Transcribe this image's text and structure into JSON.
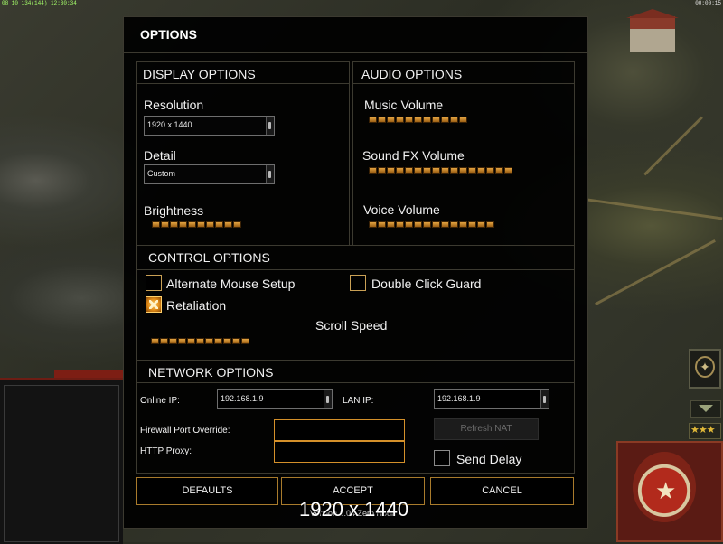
{
  "hud": {
    "top_left_readout": "08 10 134(144) 12:30:34",
    "top_right_readout": "00:00:15"
  },
  "dialog": {
    "title": "OPTIONS",
    "display": {
      "header": "DISPLAY OPTIONS",
      "resolution_label": "Resolution",
      "resolution_value": "1920 x 1440",
      "detail_label": "Detail",
      "detail_value": "Custom",
      "brightness_label": "Brightness",
      "brightness_segments": 10
    },
    "audio": {
      "header": "AUDIO OPTIONS",
      "music_label": "Music Volume",
      "music_segments": 11,
      "sfx_label": "Sound FX Volume",
      "sfx_segments": 16,
      "voice_label": "Voice Volume",
      "voice_segments": 14
    },
    "control": {
      "header": "CONTROL OPTIONS",
      "alt_mouse_label": "Alternate Mouse Setup",
      "alt_mouse_checked": false,
      "double_click_label": "Double Click Guard",
      "double_click_checked": false,
      "retaliation_label": "Retaliation",
      "retaliation_checked": true,
      "scroll_speed_label": "Scroll Speed",
      "scroll_segments": 11
    },
    "network": {
      "header": "NETWORK OPTIONS",
      "online_ip_label": "Online IP:",
      "online_ip_value": "192.168.1.9",
      "lan_ip_label": "LAN IP:",
      "lan_ip_value": "192.168.1.9",
      "firewall_label": "Firewall Port Override:",
      "firewall_value": "",
      "proxy_label": "HTTP Proxy:",
      "proxy_value": "",
      "refresh_nat_label": "Refresh NAT",
      "send_delay_label": "Send Delay",
      "send_delay_checked": false
    },
    "buttons": {
      "defaults": "DEFAULTS",
      "accept": "ACCEPT",
      "cancel": "CANCEL"
    }
  },
  "overlay": {
    "resolution_text": "1920 x 1440",
    "version_text": "Version 1.04 Zero Hour"
  },
  "colors": {
    "accent": "#d4902a",
    "slider_fill": "#e3a442",
    "panel_border": "#3c3a30"
  },
  "icons": {
    "radar": "radar-icon",
    "arrow": "chevron-down-icon",
    "rank": "rank-stars-icon",
    "emblem": "faction-emblem-icon"
  }
}
